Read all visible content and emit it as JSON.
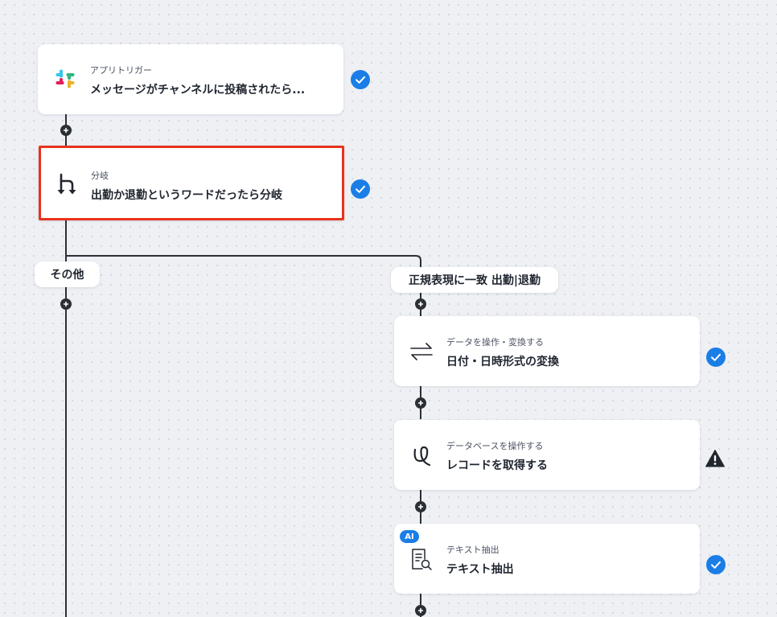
{
  "flow": {
    "nodes": [
      {
        "subtitle": "アプリトリガー",
        "title": "メッセージがチャンネルに投稿されたら...",
        "icon": "slack-icon",
        "status": "success"
      },
      {
        "subtitle": "分岐",
        "title": "出勤か退勤というワードだったら分岐",
        "icon": "branch-icon",
        "status": "success",
        "selected": true
      },
      {
        "subtitle": "データを操作・変換する",
        "title": "日付・日時形式の変換",
        "icon": "convert-arrows-icon",
        "status": "success"
      },
      {
        "subtitle": "データベースを操作する",
        "title": "レコードを取得する",
        "icon": "database-icon",
        "status": "warning"
      },
      {
        "subtitle": "テキスト抽出",
        "title": "テキスト抽出",
        "icon": "document-search-icon",
        "status": "success",
        "badge": "AI"
      }
    ],
    "branches": {
      "other_label": "その他",
      "match_label": "正規表現に一致 出勤|退勤"
    }
  },
  "colors": {
    "accent": "#1a7ee6",
    "selected_border": "#e8331c",
    "warning": "#22262e",
    "connector": "#2b2f36"
  }
}
